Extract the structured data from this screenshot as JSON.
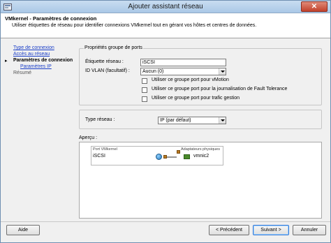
{
  "window": {
    "title": "Ajouter assistant réseau",
    "close_glyph": "✕"
  },
  "header": {
    "title": "VMkernel - Paramètres de connexion",
    "description": "Utiliser étiquettes de réseau pour identifier connexions VMkernel tout en gérant vos hôtes et centres de données."
  },
  "nav": {
    "items": [
      {
        "label": "Type de connexion",
        "state": "link"
      },
      {
        "label": "Accès au réseau",
        "state": "link"
      },
      {
        "label": "Paramètres de connexion",
        "state": "current"
      },
      {
        "label": "Paramètres IP",
        "state": "link"
      },
      {
        "label": "Résumé",
        "state": "disabled"
      }
    ]
  },
  "port_group": {
    "legend": "Propriétés groupe de ports",
    "label_network": "Étiquette réseau :",
    "network_value": "iSCSI",
    "label_vlan": "ID VLAN (facultatif) :",
    "vlan_value": "Aucun (0)",
    "checkboxes": [
      {
        "label": "Utiliser ce groupe port pour vMotion",
        "checked": false
      },
      {
        "label": "Utiliser ce groupe port pour la journalisation de Fault Tolerance",
        "checked": false
      },
      {
        "label": "Utiliser ce groupe port pour trafic gestion",
        "checked": false
      }
    ]
  },
  "network_type": {
    "label": "Type réseau :",
    "value": "IP (par défaut)"
  },
  "preview": {
    "label": "Aperçu :",
    "port_header": "Port VMkernel",
    "port_name": "iSCSI",
    "adapter_header": "Adaptateurs physiques",
    "adapter_name": "vmnic2"
  },
  "footer": {
    "help": "Aide",
    "previous": "< Précédent",
    "next": "Suivant >",
    "cancel": "Annuler"
  }
}
